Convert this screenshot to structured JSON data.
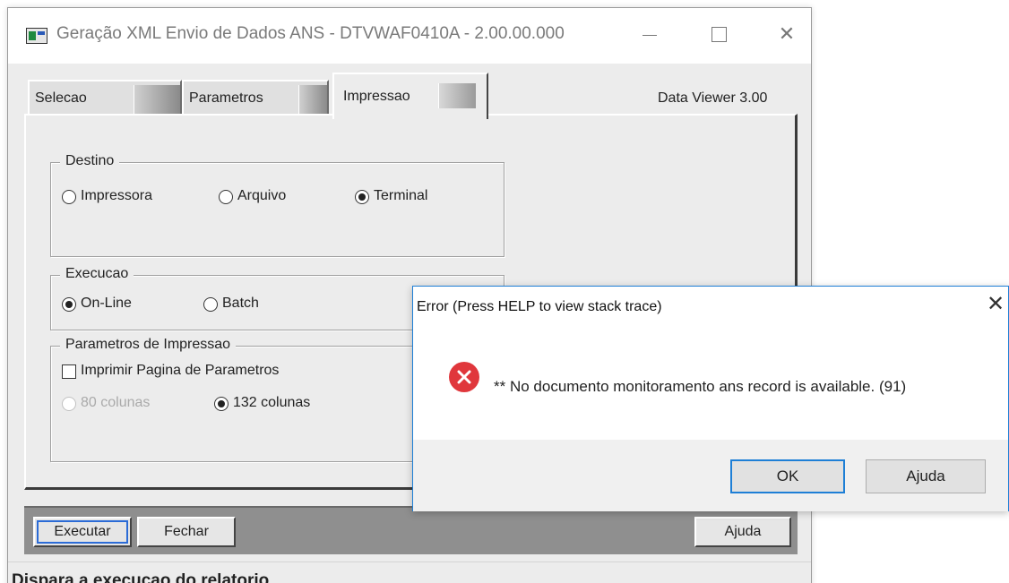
{
  "main_window": {
    "title": "Geração XML Envio de Dados ANS - DTVWAF0410A - 2.00.00.000",
    "controls": {
      "minimize": "—",
      "maximize": "☐",
      "close": "✕"
    }
  },
  "tabs": [
    {
      "label": "Selecao",
      "selected": false
    },
    {
      "label": "Parametros",
      "selected": false
    },
    {
      "label": "Impressao",
      "selected": true
    }
  ],
  "data_viewer_label": "Data Viewer 3.00",
  "destino": {
    "title": "Destino",
    "options": [
      {
        "label": "Impressora",
        "checked": false
      },
      {
        "label": "Arquivo",
        "checked": false
      },
      {
        "label": "Terminal",
        "checked": true
      }
    ]
  },
  "execucao": {
    "title": "Execucao",
    "options": [
      {
        "label": "On-Line",
        "checked": true
      },
      {
        "label": "Batch",
        "checked": false
      }
    ]
  },
  "parametros_impressao": {
    "title": "Parametros de Impressao",
    "print_params_checkbox": {
      "label": "Imprimir Pagina de Parametros",
      "checked": false
    },
    "columns": [
      {
        "label": "80 colunas",
        "checked": false,
        "disabled": true
      },
      {
        "label": "132 colunas",
        "checked": true,
        "disabled": false
      }
    ]
  },
  "buttons": {
    "executar": "Executar",
    "fechar": "Fechar",
    "ajuda": "Ajuda"
  },
  "status_bar": "Dispara a execucao do relatorio",
  "error_dialog": {
    "title": "Error (Press HELP to view stack trace)",
    "close": "✕",
    "message": "** No documento monitoramento ans record is available. (91)",
    "ok_label": "OK",
    "help_label": "Ajuda"
  },
  "colors": {
    "error_icon": "#e0373c",
    "focus_blue": "#1e7fd6"
  }
}
